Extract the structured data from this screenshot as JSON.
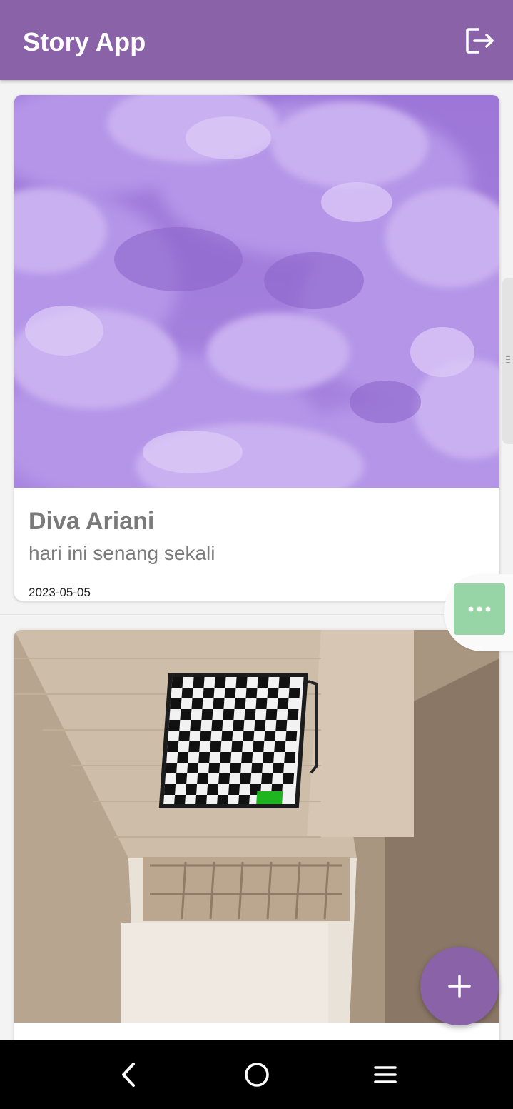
{
  "app": {
    "title": "Story App",
    "accent_color": "#8a62a8",
    "logout_icon": "logout-icon"
  },
  "stories": [
    {
      "name": "Diva Ariani",
      "description": "hari ini senang sekali",
      "date": "2023-05-05",
      "photo": "purple-clouds-photo"
    },
    {
      "name": "",
      "description": "",
      "date": "",
      "photo": "room-interior-photo"
    }
  ],
  "overlay": {
    "more_icon": "more-horizontal-icon",
    "more_color": "#97d4a6"
  },
  "fab": {
    "icon": "plus-icon"
  },
  "system_nav": {
    "back_icon": "back-icon",
    "home_icon": "home-icon",
    "recents_icon": "menu-icon"
  }
}
